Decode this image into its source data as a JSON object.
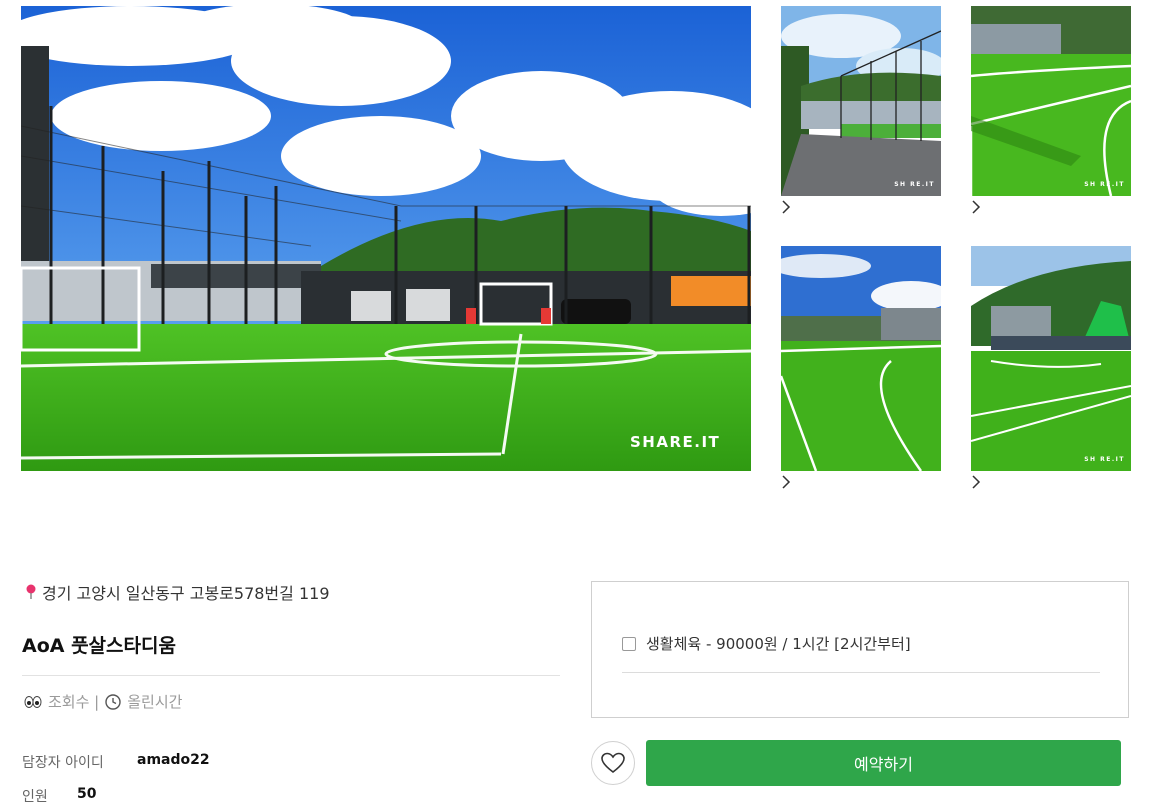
{
  "gallery": {
    "main_watermark": "SHARE.IT",
    "thumb_watermark": "SH RE.IT"
  },
  "venue": {
    "address": "경기 고양시 일산동구 고봉로578번길 119",
    "name": "AoA 풋살스타디움",
    "views_label": "조회수 |",
    "posted_label": "올린시간",
    "manager_id_label": "담장자 아이디",
    "manager_id_value": "amado22",
    "capacity_label": "인원",
    "capacity_value": "50"
  },
  "booking": {
    "option_label": "생활체육 - 90000원 / 1시간 [2시간부터]",
    "reserve_label": "예약하기"
  },
  "icons": {
    "location": "location-pin-icon",
    "views": "eyes-icon",
    "time": "clock-icon",
    "favorite": "heart-icon",
    "next": "chevron-right-icon"
  },
  "colors": {
    "accent": "#2fa64a",
    "pin": "#e8336d",
    "muted": "#9a9a9a"
  }
}
